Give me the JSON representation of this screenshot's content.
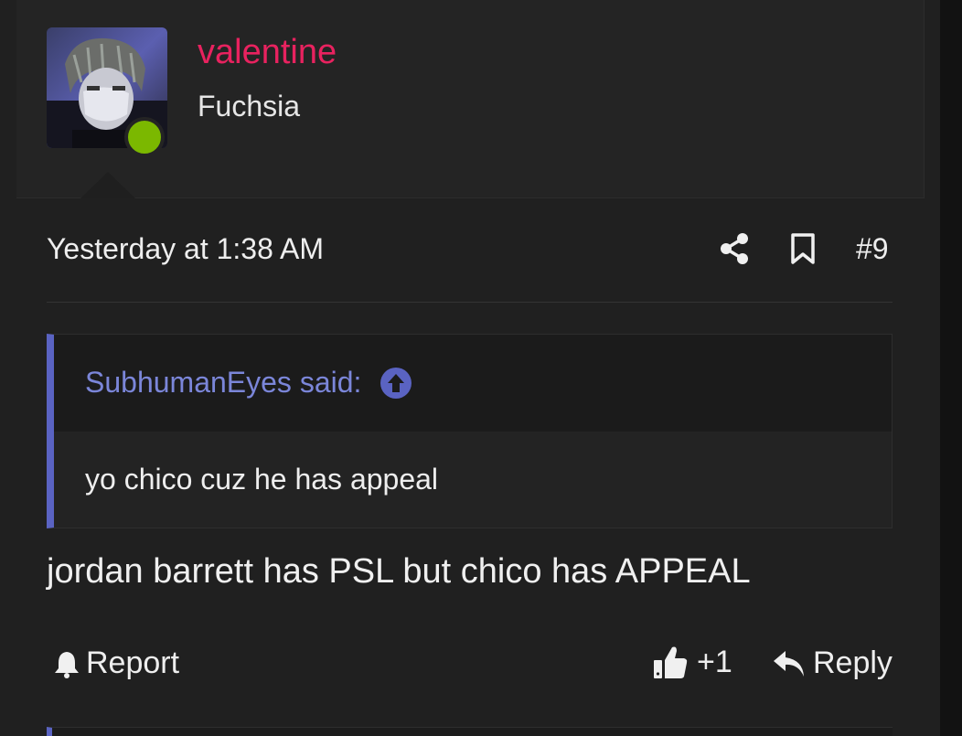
{
  "user": {
    "name": "valentine",
    "title": "Fuchsia",
    "avatar_icon": "user-avatar-photo",
    "status_color": "#7bb800"
  },
  "meta": {
    "date": "Yesterday at 1:38 AM",
    "post_number": "#9",
    "share_icon": "share-icon",
    "bookmark_icon": "bookmark-icon"
  },
  "quote": {
    "attribution": "SubhumanEyes said:",
    "text": "yo chico cuz he has appeal",
    "jump_icon": "arrow-up-circle-icon"
  },
  "message": {
    "text": "jordan barrett has PSL but chico has APPEAL"
  },
  "actions": {
    "report_label": "Report",
    "like_count": "+1",
    "reply_label": "Reply"
  },
  "colors": {
    "username": "#e8225f",
    "quote_accent": "#5a63c2",
    "quote_attribution": "#7b86d9",
    "background": "#202020"
  }
}
